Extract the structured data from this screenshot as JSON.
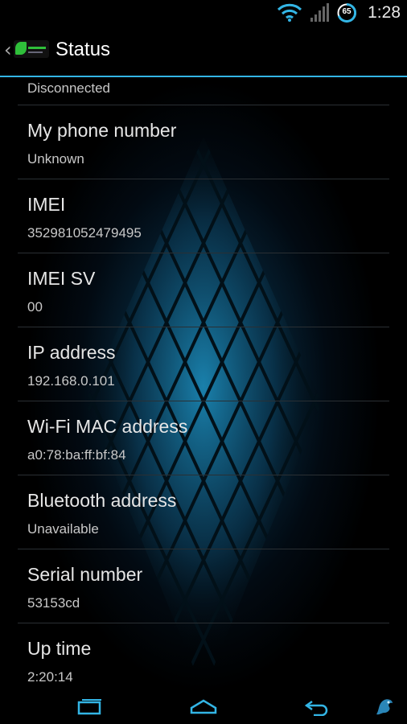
{
  "status_bar": {
    "time": "1:28",
    "battery_level": "65",
    "icons": [
      "wifi-icon",
      "signal-icon",
      "battery-icon"
    ]
  },
  "action_bar": {
    "title": "Status",
    "icon": "app-icon"
  },
  "accent_color": "#33b5e5",
  "items": [
    {
      "label": "",
      "value": "Disconnected"
    },
    {
      "label": "My phone number",
      "value": "Unknown"
    },
    {
      "label": "IMEI",
      "value": "352981052479495"
    },
    {
      "label": "IMEI SV",
      "value": "00"
    },
    {
      "label": "IP address",
      "value": "192.168.0.101"
    },
    {
      "label": "Wi-Fi MAC address",
      "value": "a0:78:ba:ff:bf:84"
    },
    {
      "label": "Bluetooth address",
      "value": "Unavailable"
    },
    {
      "label": "Serial number",
      "value": "53153cd"
    },
    {
      "label": "Up time",
      "value": "2:20:14"
    }
  ],
  "nav_bar": {
    "icons": [
      "recent-apps-icon",
      "home-icon",
      "back-icon",
      "dragon-icon"
    ]
  }
}
